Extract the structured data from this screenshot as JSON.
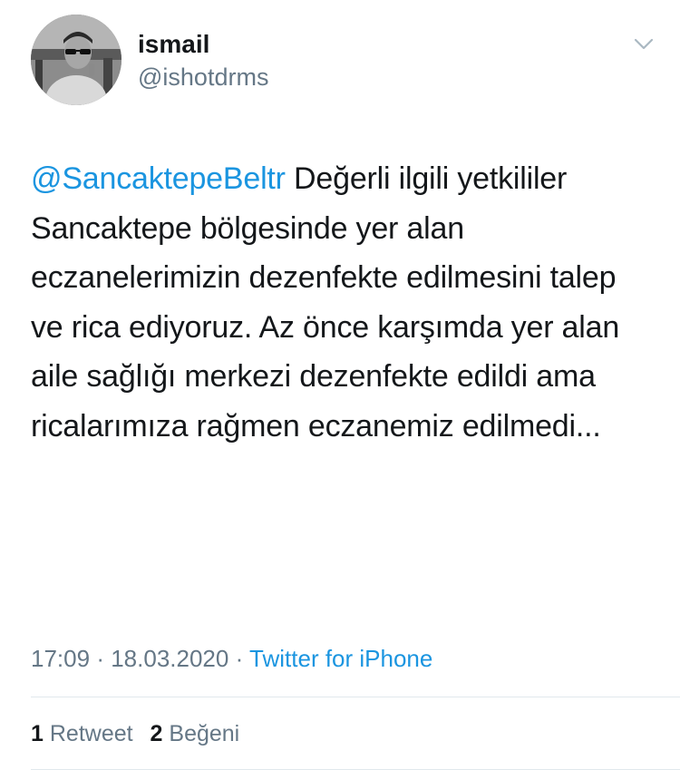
{
  "user": {
    "name": "ismail",
    "handle": "@ishotdrms"
  },
  "icons": {
    "menu": "chevron-down-icon",
    "avatar": "profile-photo"
  },
  "tweet": {
    "mention": "@SancaktepeBeltr",
    "text": " Değerli ilgili yetkililer Sancaktepe bölgesinde yer alan eczanelerimizin dezenfekte edilmesini talep ve rica ediyoruz. Az önce karşımda yer alan aile sağlığı merkezi dezenfekte edildi ama ricalarımıza rağmen eczanemiz edilmedi..."
  },
  "meta": {
    "time": "17:09",
    "separator": "·",
    "date": "18.03.2020",
    "source": "Twitter for iPhone"
  },
  "stats": {
    "retweet_count": "1",
    "retweet_label": "Retweet",
    "like_count": "2",
    "like_label": "Beğeni"
  },
  "colors": {
    "link": "#1b95e0",
    "secondary": "#657786",
    "primary_text": "#14171a",
    "divider": "#e1e8ed"
  }
}
